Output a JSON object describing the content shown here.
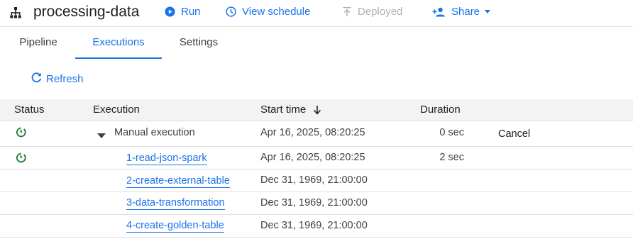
{
  "header": {
    "title": "processing-data",
    "run_label": "Run",
    "view_schedule_label": "View schedule",
    "deployed_label": "Deployed",
    "share_label": "Share"
  },
  "tabs": [
    {
      "label": "Pipeline",
      "active": false
    },
    {
      "label": "Executions",
      "active": true
    },
    {
      "label": "Settings",
      "active": false
    }
  ],
  "toolbar": {
    "refresh_label": "Refresh"
  },
  "table": {
    "columns": {
      "status": "Status",
      "execution": "Execution",
      "start_time": "Start time",
      "duration": "Duration"
    },
    "sort": {
      "column": "start_time",
      "direction": "desc"
    },
    "rows": [
      {
        "status": "running-icon",
        "execution": "Manual execution",
        "start_time": "Apr 16, 2025, 08:20:25",
        "duration": "0 sec",
        "action": "Cancel"
      },
      {
        "status": "running-icon",
        "execution": "1-read-json-spark",
        "start_time": "Apr 16, 2025, 08:20:25",
        "duration": "2 sec",
        "action": ""
      },
      {
        "status": "",
        "execution": "2-create-external-table",
        "start_time": "Dec 31, 1969, 21:00:00",
        "duration": "",
        "action": ""
      },
      {
        "status": "",
        "execution": "3-data-transformation",
        "start_time": "Dec 31, 1969, 21:00:00",
        "duration": "",
        "action": ""
      },
      {
        "status": "",
        "execution": "4-create-golden-table",
        "start_time": "Dec 31, 1969, 21:00:00",
        "duration": "",
        "action": ""
      }
    ]
  },
  "colors": {
    "accent": "#1a73e8",
    "success": "#188038",
    "disabled": "#aab0b6"
  }
}
